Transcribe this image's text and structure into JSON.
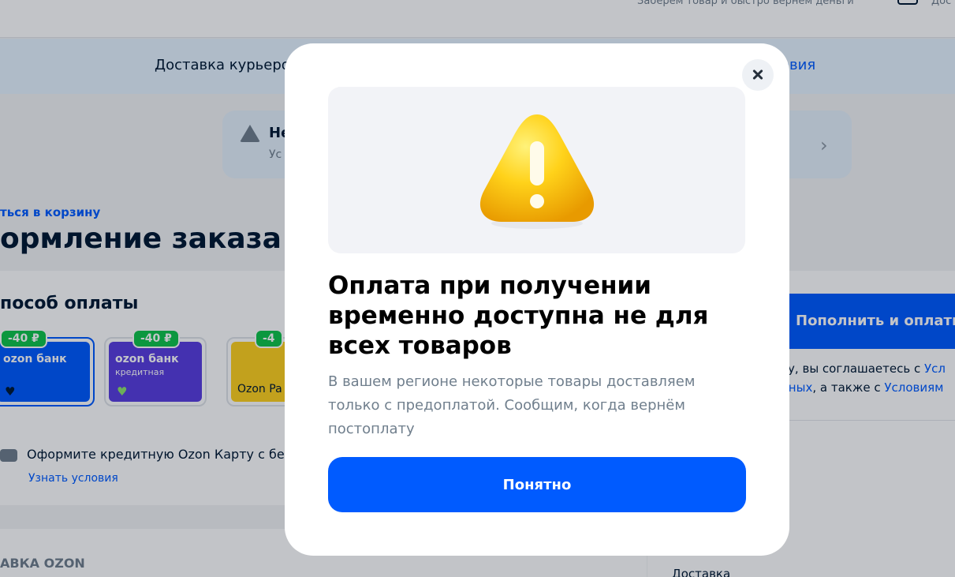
{
  "header": {
    "promo_text": "Заберем товар и быстро вернем деньги",
    "right_label": "Дос",
    "icon": "cart-icon"
  },
  "delivery_bar": {
    "text": "Доставка курьеро",
    "link": "овия"
  },
  "notice": {
    "title": "Не",
    "subtitle": "Ус",
    "icon": "warning-icon"
  },
  "page": {
    "back_link": "ться в корзину",
    "title": "ормление заказа"
  },
  "payment": {
    "title": "пособ оплаты",
    "methods": [
      {
        "badge": "-40 ₽",
        "name": "ozon банк",
        "sub": "",
        "selected": true
      },
      {
        "badge": "-40 ₽",
        "name": "ozon банк",
        "sub": "кредитная",
        "selected": false
      },
      {
        "badge": "-4",
        "name": "Ozon Pa",
        "sub": "",
        "selected": false
      }
    ],
    "credit_text": "Оформите кредитную Ozon Карту с бе",
    "credit_link": "Узнать условия"
  },
  "delivery_section": {
    "title": "АВКА OZON"
  },
  "summary": {
    "pay_button": "Пополнить и оплатит",
    "agree_line1_text": "ку, вы соглашаетесь с ",
    "agree_line1_link": "Усл",
    "agree_line2_link1": "нных",
    "agree_line2_text": ", а также с ",
    "agree_line2_link2": "Условиям",
    "delivery_label": "Доставка"
  },
  "modal": {
    "title": "Оплата при получении временно доступна не для всех товаров",
    "text": "В вашем регионе некоторые товары доставляем только с предоплатой. Сообщим, когда вернём постоплату",
    "ok_button": "Понятно",
    "close_icon": "close-icon",
    "illustration_icon": "warning-icon"
  },
  "colors": {
    "accent": "#005bff",
    "badge": "#10c44c",
    "warning_yellow": "#ffc400"
  }
}
